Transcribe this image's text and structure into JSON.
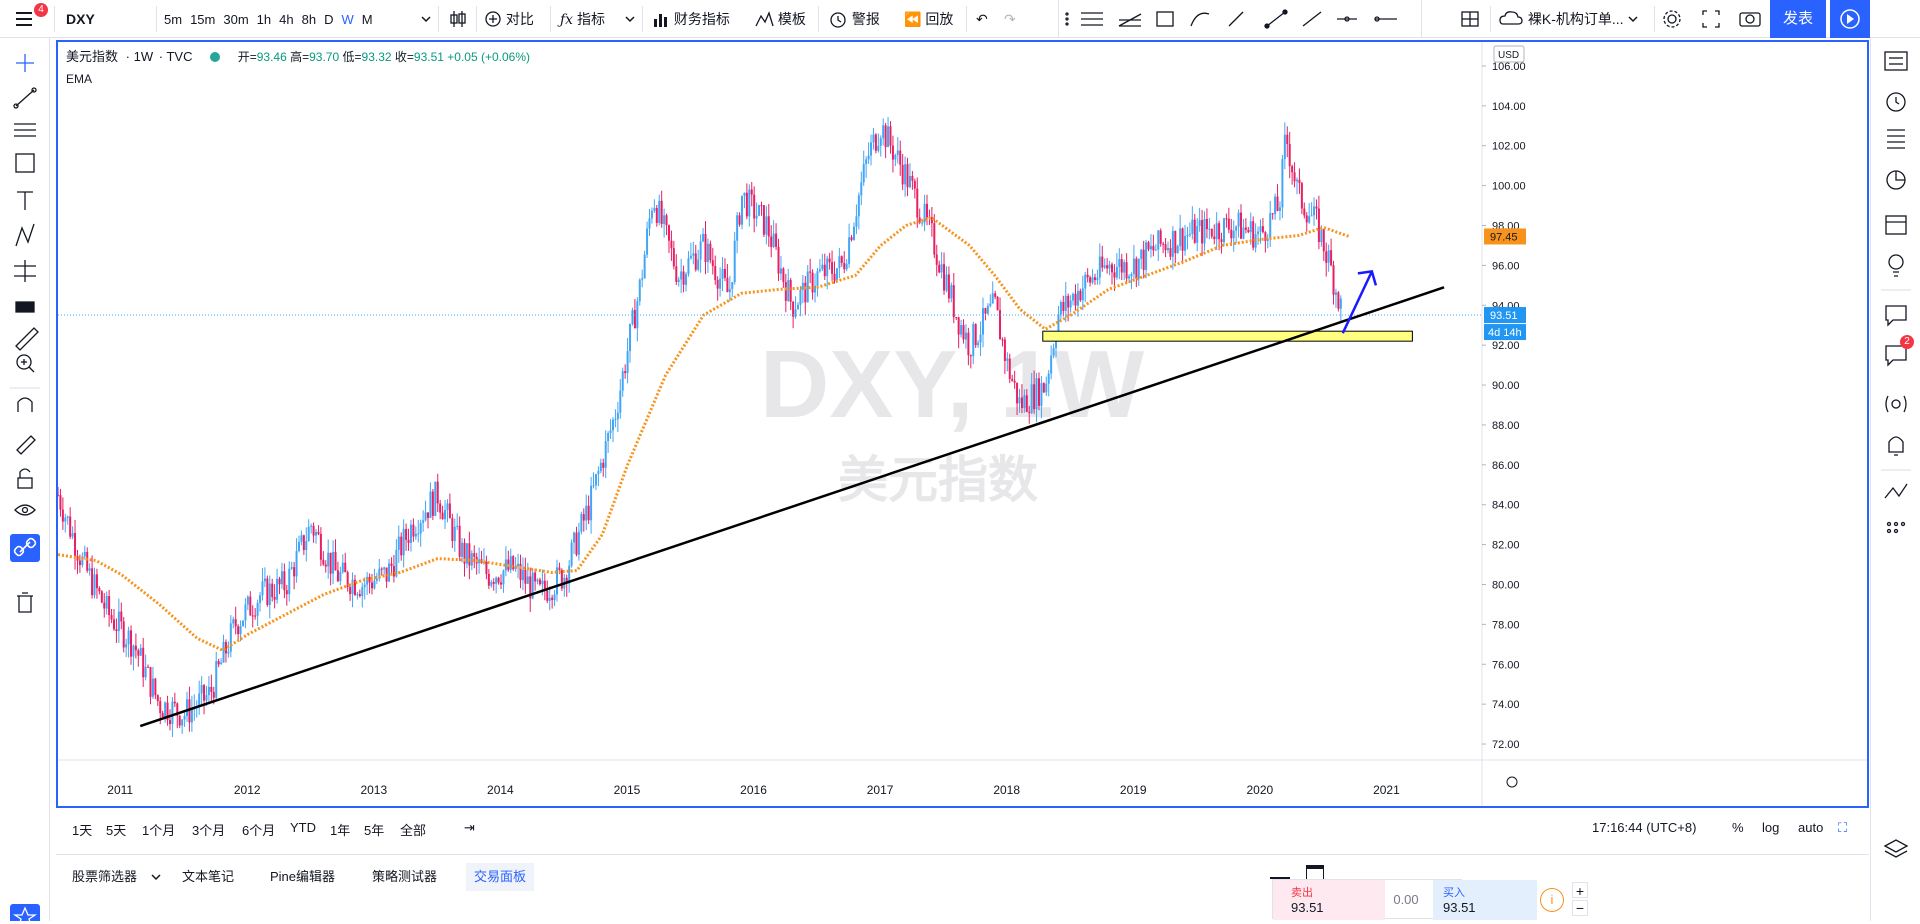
{
  "toolbar": {
    "menu_badge": "4",
    "symbol": "DXY",
    "intervals": [
      "5m",
      "15m",
      "30m",
      "1h",
      "4h",
      "8h",
      "D",
      "W",
      "M"
    ],
    "active_interval": "W",
    "compare_label": "对比",
    "indicators_label": "指标",
    "financials_label": "财务指标",
    "templates_label": "模板",
    "alert_label": "警报",
    "replay_label": "回放",
    "layout_name": "裸K-机构订单...",
    "publish_label": "发表"
  },
  "legend": {
    "name": "美元指数",
    "interval": "1W",
    "source": "TVC",
    "open_label": "开=",
    "open": "93.46",
    "high_label": "高=",
    "high": "93.70",
    "low_label": "低=",
    "low": "93.32",
    "close_label": "收=",
    "close": "93.51",
    "change": "+0.05 (+0.06%)",
    "indicator": "EMA"
  },
  "watermark": {
    "symbol_line": "DXY, 1W",
    "name_line": "美元指数"
  },
  "price_axis": {
    "currency": "USD",
    "ticks": [
      "106.00",
      "104.00",
      "102.00",
      "100.00",
      "98.00",
      "96.00",
      "94.00",
      "92.00",
      "90.00",
      "88.00",
      "86.00",
      "84.00",
      "82.00",
      "80.00",
      "78.00",
      "76.00",
      "74.00",
      "72.00"
    ],
    "ema_label": "97.45",
    "last_price_label": "93.51",
    "countdown_label": "4d 14h"
  },
  "time_axis": {
    "ticks": [
      "2011",
      "2012",
      "2013",
      "2014",
      "2015",
      "2016",
      "2017",
      "2018",
      "2019",
      "2020",
      "2021"
    ]
  },
  "range_bar": {
    "ranges": [
      "1天",
      "5天",
      "1个月",
      "3个月",
      "6个月",
      "YTD",
      "1年",
      "5年",
      "全部"
    ],
    "clock": "17:16:44 (UTC+8)",
    "percent_label": "%",
    "log_label": "log",
    "auto_label": "auto"
  },
  "bottom_tabs": {
    "tabs": [
      "股票筛选器",
      "文本笔记",
      "Pine编辑器",
      "策略测试器",
      "交易面板"
    ],
    "active": "交易面板"
  },
  "trade": {
    "sell_label": "卖出",
    "sell_price": "93.51",
    "spread": "0.00",
    "buy_label": "买入",
    "buy_price": "93.51"
  },
  "right_badge": "2",
  "colors": {
    "accent": "#2962ff",
    "up": "#26a69a",
    "up_candle": "#42a5f5",
    "down_candle": "#e91e63",
    "ema": "#f7931a",
    "trendline": "#000000",
    "zone": "#ffff80",
    "arrow": "#1a1aff"
  },
  "chart_data": {
    "type": "candlestick",
    "y_range": [
      71.2,
      107.2
    ],
    "x_range_years": [
      2010.5,
      2021.75
    ],
    "ema_series": [
      [
        2010.5,
        81.5
      ],
      [
        2010.8,
        81.2
      ],
      [
        2011.0,
        80.5
      ],
      [
        2011.3,
        79.0
      ],
      [
        2011.6,
        77.3
      ],
      [
        2011.8,
        76.7
      ],
      [
        2012.0,
        77.5
      ],
      [
        2012.3,
        78.5
      ],
      [
        2012.6,
        79.5
      ],
      [
        2012.9,
        80.2
      ],
      [
        2013.2,
        80.6
      ],
      [
        2013.5,
        81.3
      ],
      [
        2013.8,
        81.2
      ],
      [
        2014.1,
        80.9
      ],
      [
        2014.4,
        80.6
      ],
      [
        2014.6,
        80.7
      ],
      [
        2014.8,
        82.5
      ],
      [
        2015.0,
        86.0
      ],
      [
        2015.3,
        90.5
      ],
      [
        2015.6,
        93.5
      ],
      [
        2015.9,
        94.6
      ],
      [
        2016.2,
        94.8
      ],
      [
        2016.5,
        94.9
      ],
      [
        2016.8,
        95.5
      ],
      [
        2017.0,
        97.0
      ],
      [
        2017.2,
        98.0
      ],
      [
        2017.4,
        98.4
      ],
      [
        2017.7,
        97.0
      ],
      [
        2017.9,
        95.5
      ],
      [
        2018.1,
        93.8
      ],
      [
        2018.3,
        92.8
      ],
      [
        2018.5,
        93.5
      ],
      [
        2018.8,
        94.8
      ],
      [
        2019.1,
        95.5
      ],
      [
        2019.4,
        96.2
      ],
      [
        2019.7,
        97.0
      ],
      [
        2020.0,
        97.3
      ],
      [
        2020.3,
        97.5
      ],
      [
        2020.5,
        97.9
      ],
      [
        2020.7,
        97.45
      ]
    ],
    "price_path": [
      [
        2010.5,
        84.5
      ],
      [
        2010.7,
        81.0
      ],
      [
        2010.9,
        78.5
      ],
      [
        2011.1,
        77.0
      ],
      [
        2011.3,
        74.0
      ],
      [
        2011.5,
        73.5
      ],
      [
        2011.7,
        74.5
      ],
      [
        2011.9,
        78.0
      ],
      [
        2012.1,
        79.5
      ],
      [
        2012.3,
        80.0
      ],
      [
        2012.5,
        83.0
      ],
      [
        2012.7,
        80.5
      ],
      [
        2012.9,
        80.0
      ],
      [
        2013.1,
        80.5
      ],
      [
        2013.3,
        83.0
      ],
      [
        2013.5,
        84.5
      ],
      [
        2013.7,
        81.5
      ],
      [
        2013.9,
        80.5
      ],
      [
        2014.1,
        80.8
      ],
      [
        2014.3,
        79.5
      ],
      [
        2014.5,
        80.5
      ],
      [
        2014.7,
        84.0
      ],
      [
        2014.9,
        88.5
      ],
      [
        2015.1,
        95.0
      ],
      [
        2015.2,
        99.5
      ],
      [
        2015.4,
        95.5
      ],
      [
        2015.6,
        97.0
      ],
      [
        2015.8,
        94.5
      ],
      [
        2015.9,
        99.5
      ],
      [
        2016.1,
        98.0
      ],
      [
        2016.3,
        94.0
      ],
      [
        2016.5,
        95.5
      ],
      [
        2016.7,
        96.0
      ],
      [
        2016.9,
        101.5
      ],
      [
        2017.0,
        103.0
      ],
      [
        2017.2,
        100.5
      ],
      [
        2017.4,
        97.5
      ],
      [
        2017.6,
        93.5
      ],
      [
        2017.7,
        92.0
      ],
      [
        2017.9,
        94.0
      ],
      [
        2018.0,
        91.0
      ],
      [
        2018.1,
        89.0
      ],
      [
        2018.3,
        90.0
      ],
      [
        2018.4,
        93.5
      ],
      [
        2018.6,
        95.0
      ],
      [
        2018.8,
        96.0
      ],
      [
        2019.0,
        96.0
      ],
      [
        2019.2,
        97.0
      ],
      [
        2019.4,
        97.5
      ],
      [
        2019.6,
        97.8
      ],
      [
        2019.8,
        98.0
      ],
      [
        2020.0,
        97.5
      ],
      [
        2020.15,
        99.0
      ],
      [
        2020.2,
        102.5
      ],
      [
        2020.3,
        99.5
      ],
      [
        2020.45,
        98.0
      ],
      [
        2020.55,
        96.0
      ],
      [
        2020.65,
        93.5
      ]
    ],
    "trendline": [
      [
        2011.15,
        72.9
      ],
      [
        2021.45,
        94.9
      ]
    ],
    "zone": {
      "x0": 2018.28,
      "x1": 2021.2,
      "y0": 92.2,
      "y1": 92.7
    },
    "arrow": [
      [
        2020.65,
        92.6
      ],
      [
        2020.88,
        95.7
      ]
    ]
  }
}
